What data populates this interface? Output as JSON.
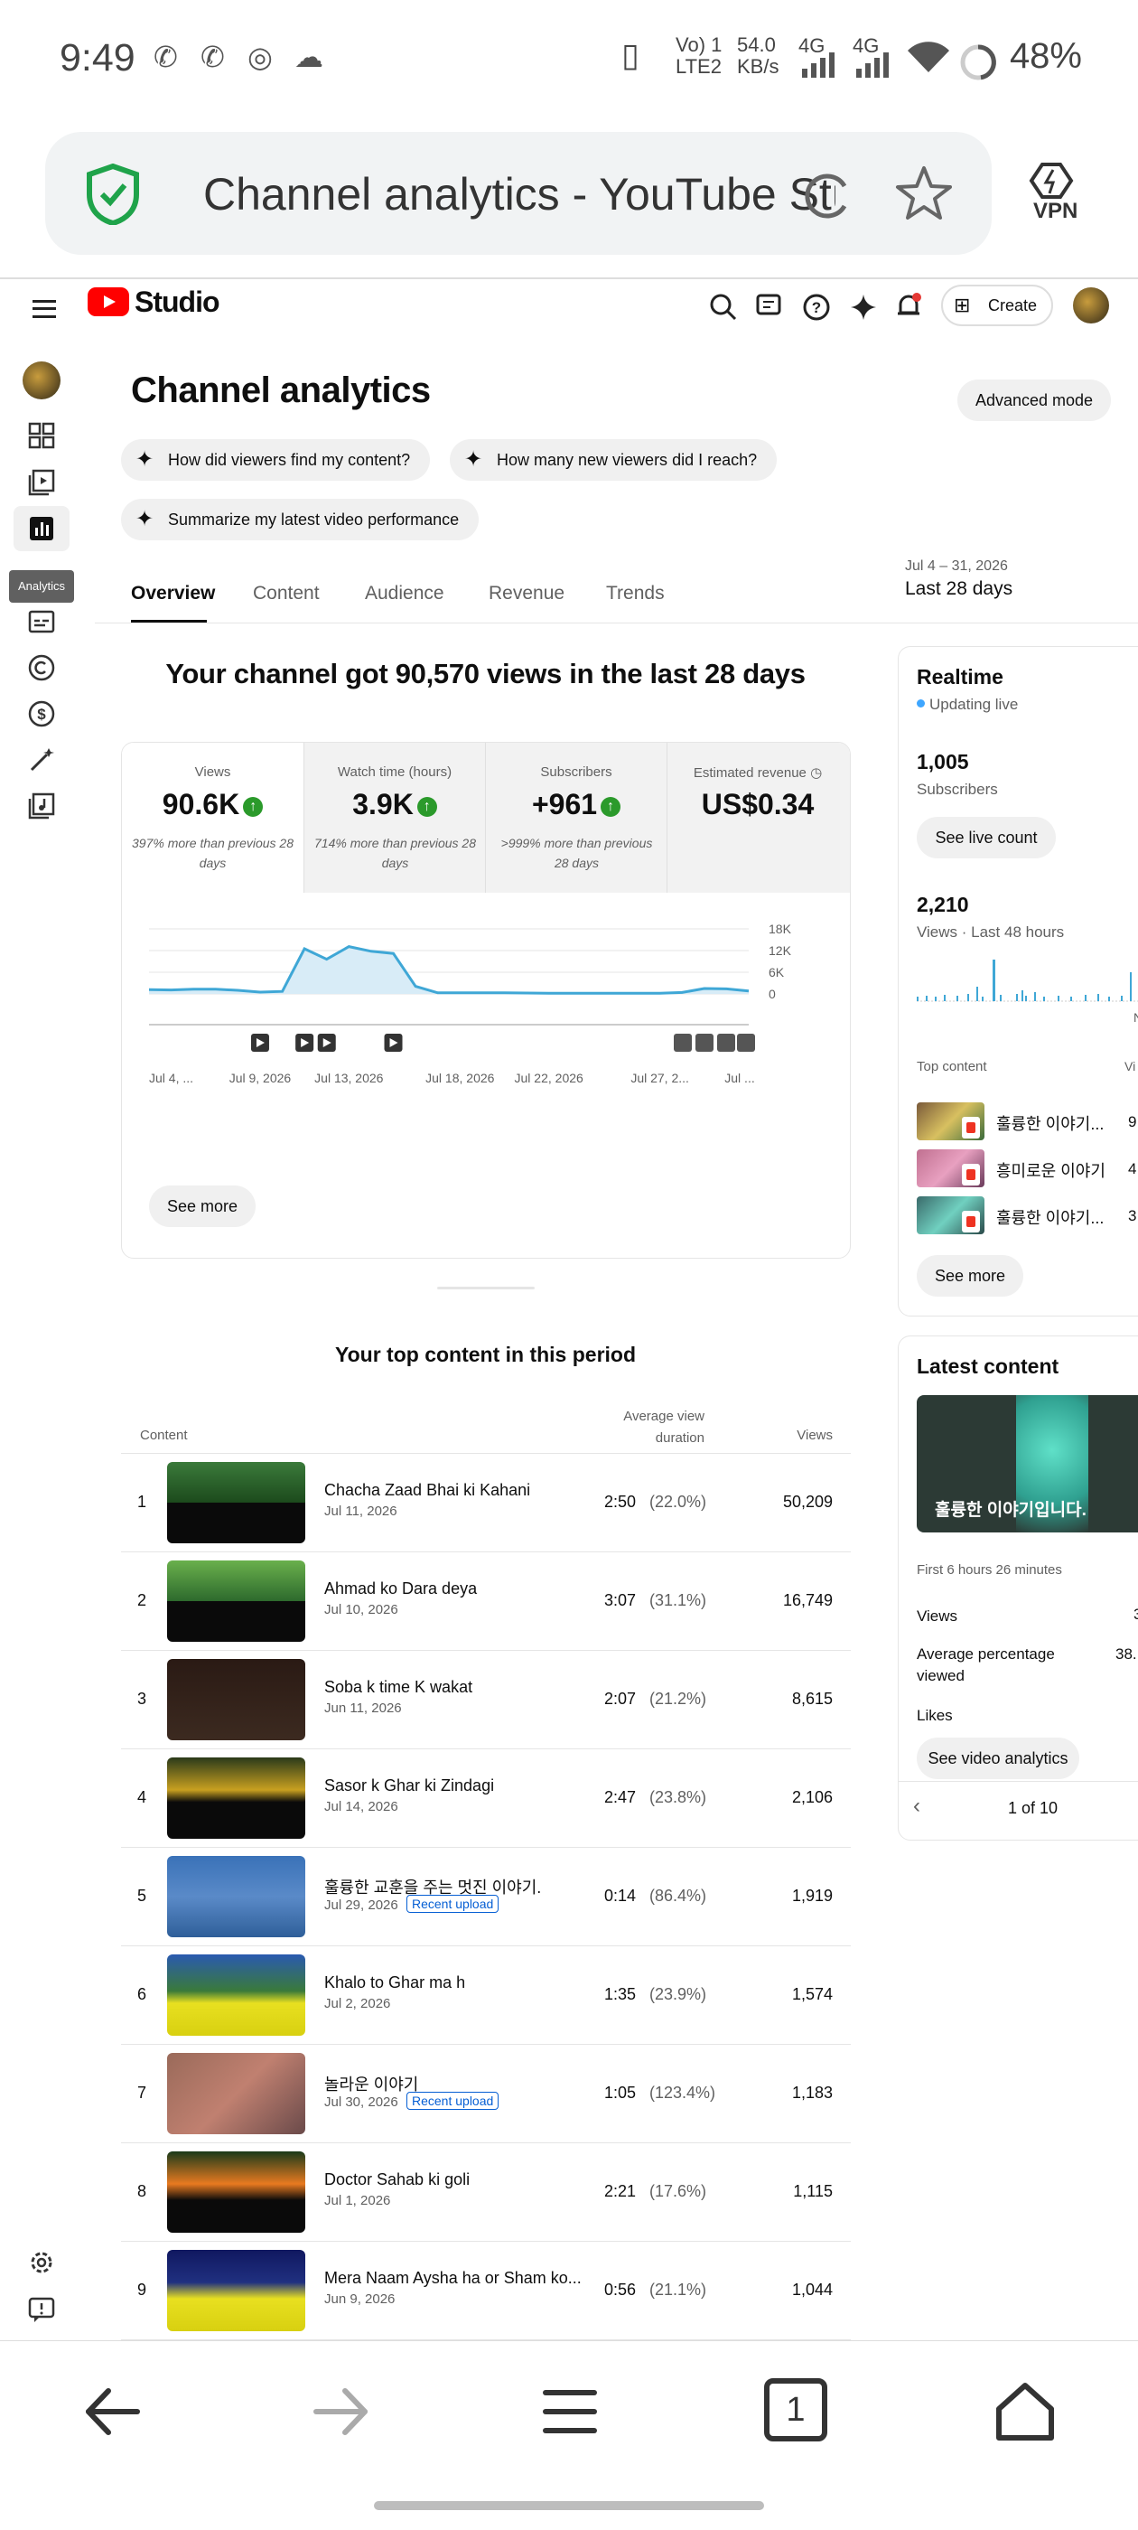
{
  "status_bar": {
    "time": "9:49",
    "network": "Vo) 1 LTE2",
    "speed": "54.0 KB/s",
    "signal1": "4G",
    "signal2": "4G",
    "battery": "48%"
  },
  "browser": {
    "tab_title": "Channel analytics - YouTube Stu",
    "vpn_label": "VPN"
  },
  "header": {
    "logo_text": "Studio",
    "create_label": "Create"
  },
  "rail": {
    "tooltip": "Analytics"
  },
  "page": {
    "title": "Channel analytics",
    "advanced_mode": "Advanced mode",
    "chips": [
      "How did viewers find my content?",
      "How many new viewers did I reach?",
      "Summarize my latest video performance"
    ],
    "tabs": [
      "Overview",
      "Content",
      "Audience",
      "Revenue",
      "Trends"
    ],
    "active_tab": "Overview",
    "date_range_sub": "Jul 4 – 31, 2026",
    "date_range_main": "Last 28 days"
  },
  "overview": {
    "headline": "Your channel got 90,570 views in the last 28 days",
    "metrics": [
      {
        "label": "Views",
        "value": "90.6K",
        "trend": "up",
        "note": "397% more than previous 28 days"
      },
      {
        "label": "Watch time (hours)",
        "value": "3.9K",
        "trend": "up",
        "note": "714% more than previous 28 days"
      },
      {
        "label": "Subscribers",
        "value": "+961",
        "trend": "up",
        "note": ">999% more than previous 28 days"
      },
      {
        "label": "Estimated revenue",
        "value": "US$0.34",
        "trend": "none",
        "note": ""
      }
    ],
    "see_more": "See more"
  },
  "chart_data": {
    "type": "area",
    "title": "",
    "x": [
      "Jul 4",
      "Jul 5",
      "Jul 6",
      "Jul 7",
      "Jul 8",
      "Jul 9",
      "Jul 10",
      "Jul 11",
      "Jul 12",
      "Jul 13",
      "Jul 14",
      "Jul 15",
      "Jul 16",
      "Jul 17",
      "Jul 18",
      "Jul 19",
      "Jul 20",
      "Jul 21",
      "Jul 22",
      "Jul 23",
      "Jul 24",
      "Jul 25",
      "Jul 26",
      "Jul 27",
      "Jul 28",
      "Jul 29",
      "Jul 30",
      "Jul 31"
    ],
    "series": [
      {
        "values": [
          1200,
          1100,
          1300,
          1300,
          1000,
          500,
          700,
          12500,
          9600,
          13100,
          11800,
          11200,
          2100,
          300,
          300,
          300,
          300,
          250,
          200,
          200,
          200,
          200,
          200,
          200,
          400,
          1500,
          1400,
          800
        ]
      }
    ],
    "x_tick_labels": [
      "Jul 4, ...",
      "Jul 9, 2026",
      "Jul 13, 2026",
      "Jul 18, 2026",
      "Jul 22, 2026",
      "Jul 27, 2...",
      "Jul ..."
    ],
    "y_tick_labels": [
      "18K",
      "12K",
      "6K",
      "0"
    ],
    "ylim": [
      0,
      18000
    ],
    "grid": true
  },
  "top_content": {
    "title": "Your top content in this period",
    "col_content": "Content",
    "col_avd": "Average view duration",
    "col_views": "Views",
    "rows": [
      {
        "rank": "1",
        "title": "Chacha Zaad Bhai ki Kahani",
        "date": "Jul 11, 2026",
        "duration": "2:50",
        "pct": "(22.0%)",
        "views": "50,209",
        "badge": ""
      },
      {
        "rank": "2",
        "title": "Ahmad ko Dara deya",
        "date": "Jul 10, 2026",
        "duration": "3:07",
        "pct": "(31.1%)",
        "views": "16,749",
        "badge": ""
      },
      {
        "rank": "3",
        "title": "Soba k time K wakat",
        "date": "Jun 11, 2026",
        "duration": "2:07",
        "pct": "(21.2%)",
        "views": "8,615",
        "badge": ""
      },
      {
        "rank": "4",
        "title": "Sasor k Ghar ki Zindagi",
        "date": "Jul 14, 2026",
        "duration": "2:47",
        "pct": "(23.8%)",
        "views": "2,106",
        "badge": ""
      },
      {
        "rank": "5",
        "title": "훌륭한 교훈을 주는 멋진 이야기.",
        "date": "Jul 29, 2026",
        "duration": "0:14",
        "pct": "(86.4%)",
        "views": "1,919",
        "badge": "Recent upload"
      },
      {
        "rank": "6",
        "title": "Khalo to Ghar ma h",
        "date": "Jul 2, 2026",
        "duration": "1:35",
        "pct": "(23.9%)",
        "views": "1,574",
        "badge": ""
      },
      {
        "rank": "7",
        "title": "놀라운 이야기",
        "date": "Jul 30, 2026",
        "duration": "1:05",
        "pct": "(123.4%)",
        "views": "1,183",
        "badge": "Recent upload"
      },
      {
        "rank": "8",
        "title": "Doctor Sahab ki goli",
        "date": "Jul 1, 2026",
        "duration": "2:21",
        "pct": "(17.6%)",
        "views": "1,115",
        "badge": ""
      },
      {
        "rank": "9",
        "title": "Mera Naam Aysha ha or Sham ko...",
        "date": "Jun 9, 2026",
        "duration": "0:56",
        "pct": "(21.1%)",
        "views": "1,044",
        "badge": ""
      }
    ]
  },
  "realtime": {
    "title": "Realtime",
    "live": "Updating live",
    "subs_value": "1,005",
    "subs_label": "Subscribers",
    "see_live_count": "See live count",
    "views_value": "2,210",
    "views_label": "Views · Last 48 hours",
    "axis_cut": "N",
    "top_content_label": "Top content",
    "top_content_col": "Vi",
    "items": [
      {
        "title": "훌륭한 이야기...",
        "value": "9"
      },
      {
        "title": "흥미로운 이야기",
        "value": "4"
      },
      {
        "title": "훌륭한 이야기...",
        "value": "3"
      }
    ],
    "see_more": "See more"
  },
  "latest": {
    "title": "Latest content",
    "thumb_text": "훌륭한 이야기입니다.",
    "first_hours": "First 6 hours 26 minutes",
    "views_label": "Views",
    "views_value": "3",
    "avg_pct_label": "Average percentage viewed",
    "avg_pct_value": "38.",
    "likes_label": "Likes",
    "see_video_analytics": "See video analytics",
    "pager": "1 of 10"
  },
  "bottom_nav": {
    "tabs_count": "1"
  }
}
